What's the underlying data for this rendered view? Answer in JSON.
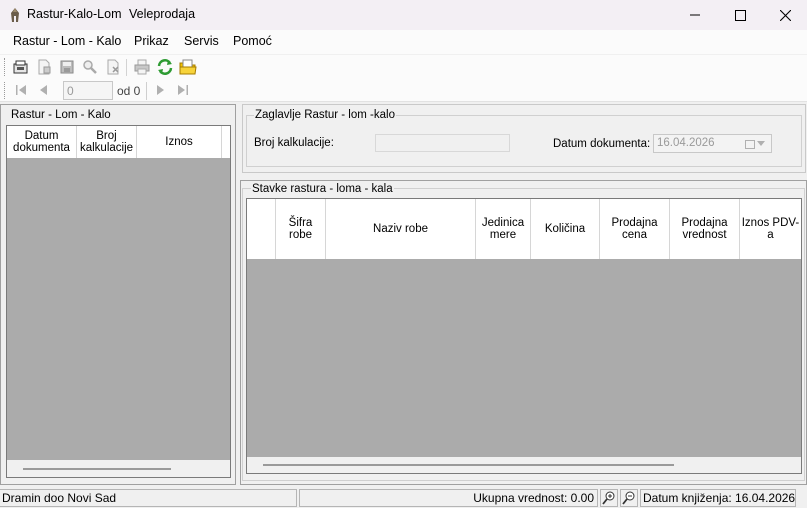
{
  "window": {
    "title": "Rastur-Kalo-Lom",
    "subtitle": "Veleprodaja",
    "controls": {
      "minimize": "─",
      "maximize": "☐",
      "close": "✕"
    }
  },
  "menu": [
    {
      "label": "Rastur - Lom - Kalo"
    },
    {
      "label": "Prikaz"
    },
    {
      "label": "Servis"
    },
    {
      "label": "Pomoć"
    }
  ],
  "toolbar": {
    "icons": [
      "new-document-icon",
      "add-document-icon",
      "save-icon",
      "search-icon",
      "delete-icon",
      "print-icon",
      "refresh-icon",
      "open-folder-icon"
    ]
  },
  "navigator": {
    "position_value": "0",
    "of_label": "od 0"
  },
  "left_panel": {
    "title": "Rastur - Lom - Kalo",
    "columns": [
      {
        "label": "Datum dokumenta"
      },
      {
        "label": "Broj kalkulacije"
      },
      {
        "label": "Iznos"
      }
    ]
  },
  "header": {
    "title": "Zaglavlje Rastur - lom -kalo",
    "broj_label": "Broj kalkulacije:",
    "broj_value": "",
    "datum_label": "Datum dokumenta:",
    "datum_value": "16.04.2026"
  },
  "items": {
    "title": "Stavke rastura - loma - kala",
    "columns": [
      {
        "label": ""
      },
      {
        "label": "Šifra robe"
      },
      {
        "label": "Naziv robe"
      },
      {
        "label": "Jedinica mere"
      },
      {
        "label": "Količina"
      },
      {
        "label": "Prodajna cena"
      },
      {
        "label": "Prodajna vrednost"
      },
      {
        "label": "Iznos PDV-a"
      }
    ]
  },
  "status": {
    "company": "Dramin doo Novi Sad",
    "total": "Ukupna vrednost: 0.00",
    "posting_date": "Datum knjiženja: 16.04.2026"
  },
  "colors": {
    "grid_background": "#ababab",
    "title_bar": "#f3eff4",
    "accent_green": "#2e9b33",
    "folder_yellow": "#f2c200"
  }
}
